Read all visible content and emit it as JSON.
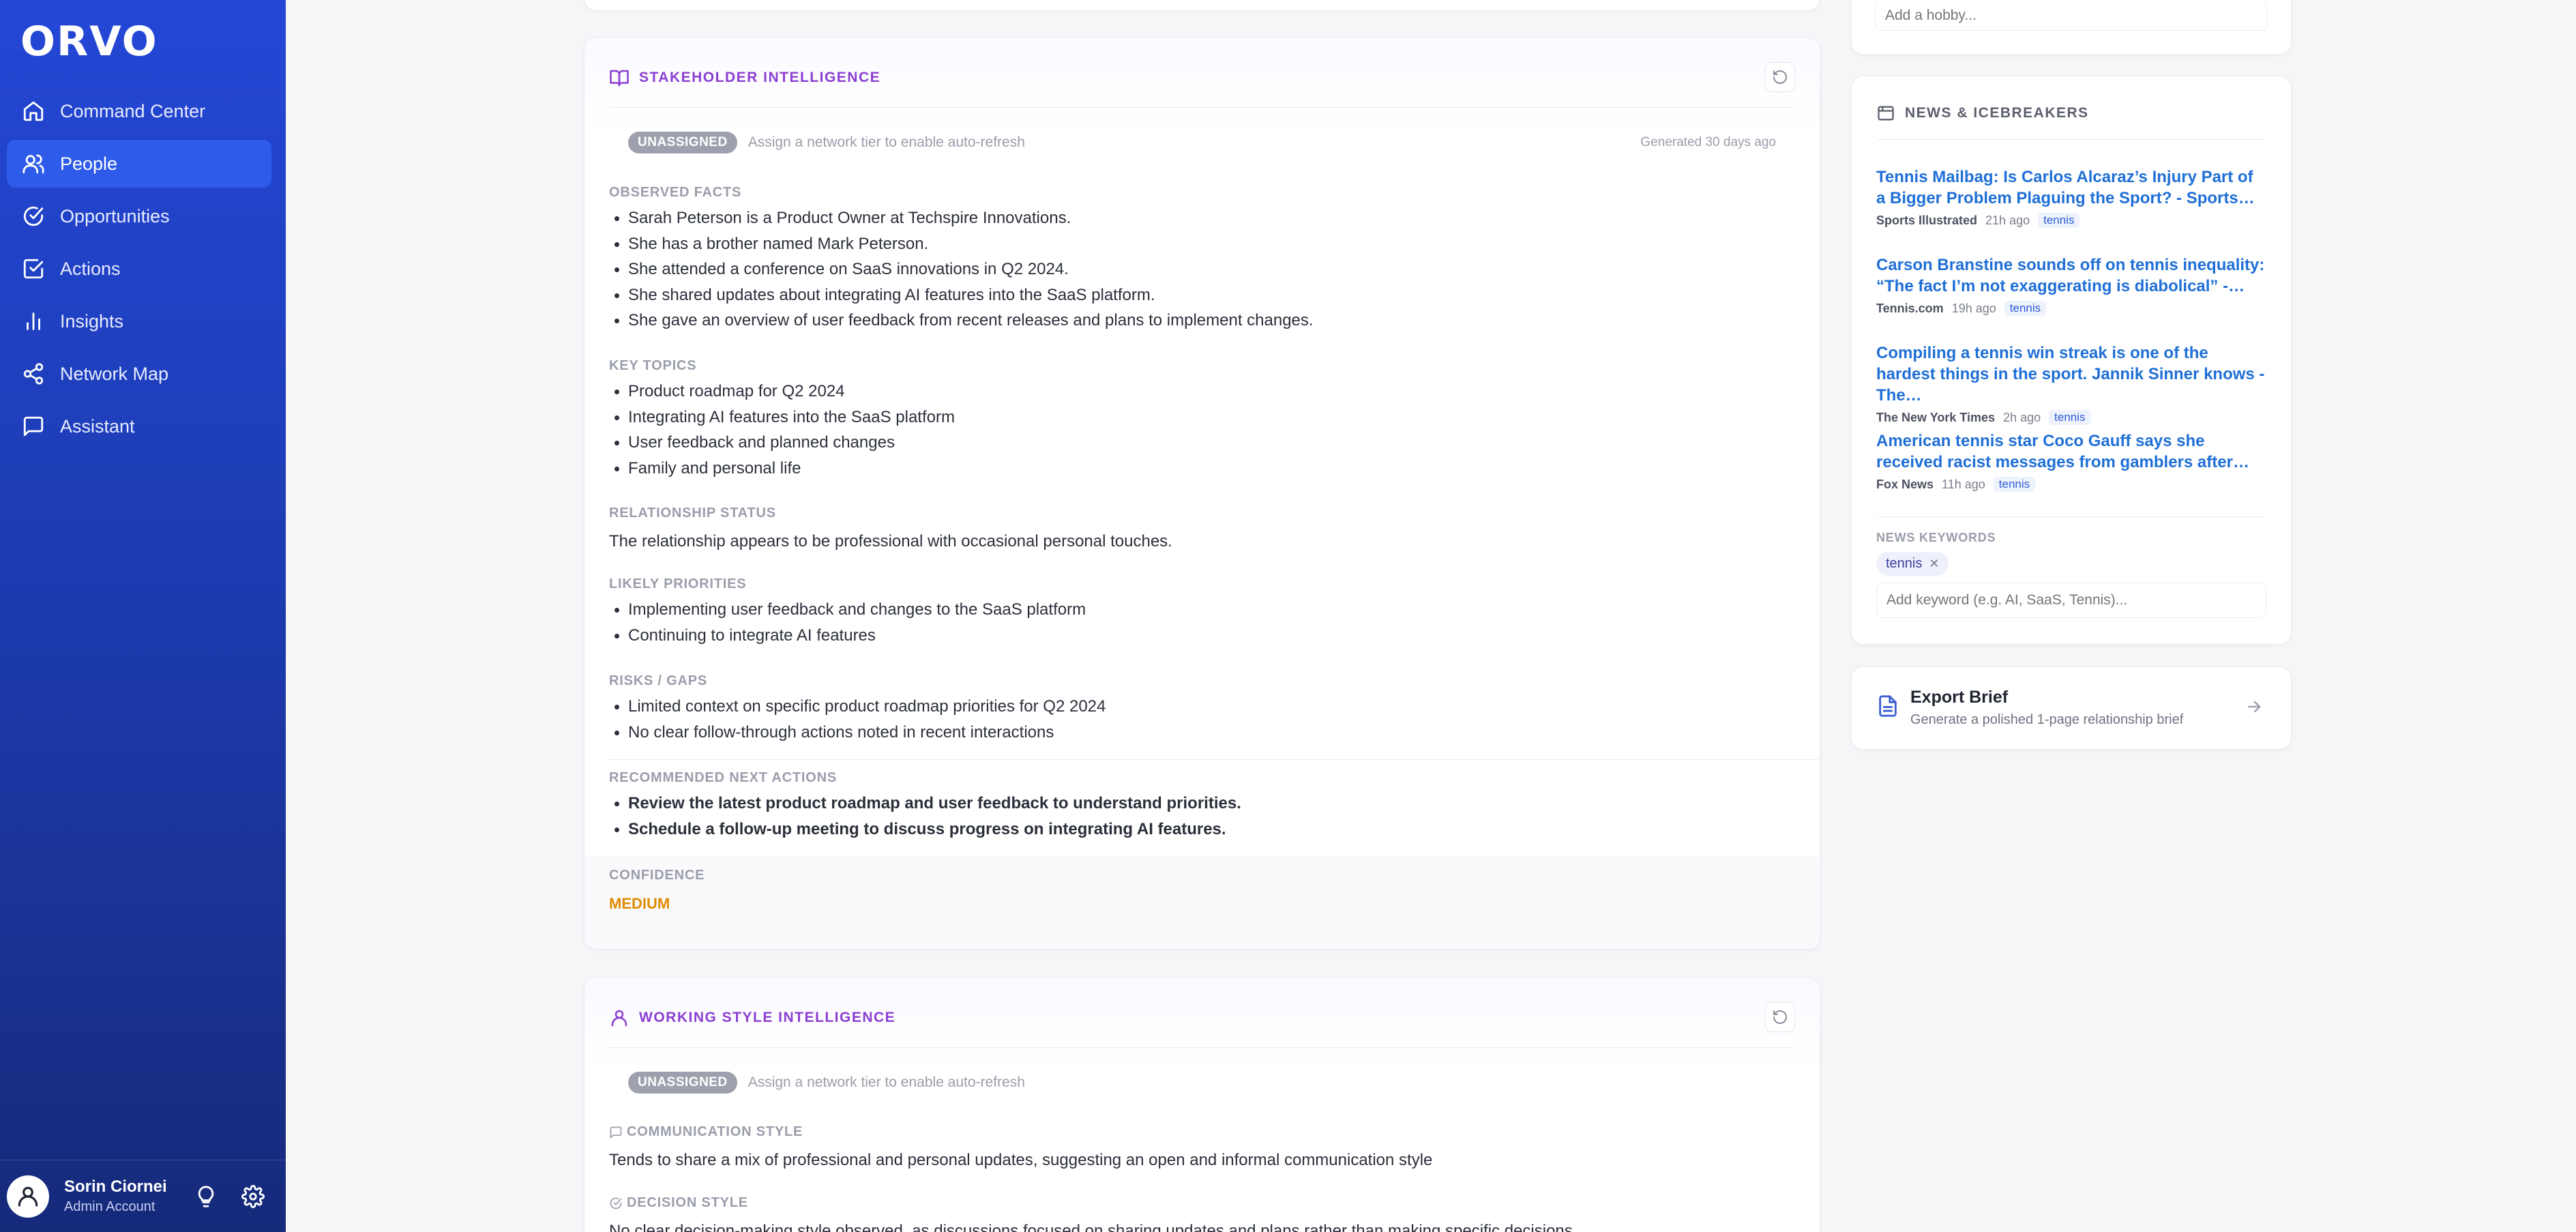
{
  "app": {
    "logo": "ORVO"
  },
  "sidebar": {
    "items": [
      {
        "label": "Command Center",
        "icon": "home-icon"
      },
      {
        "label": "People",
        "icon": "users-icon",
        "active": true
      },
      {
        "label": "Opportunities",
        "icon": "check-circle-icon"
      },
      {
        "label": "Actions",
        "icon": "check-square-icon"
      },
      {
        "label": "Insights",
        "icon": "bar-chart-icon"
      },
      {
        "label": "Network Map",
        "icon": "share-icon"
      },
      {
        "label": "Assistant",
        "icon": "message-square-icon"
      }
    ],
    "user": {
      "name": "Sorin Ciornei",
      "role": "Admin Account"
    }
  },
  "stakeholder": {
    "title": "STAKEHOLDER INTELLIGENCE",
    "badge": "UNASSIGNED",
    "hint": "Assign a network tier to enable auto-refresh",
    "generated": "Generated 30 days ago",
    "observed_label": "OBSERVED FACTS",
    "observed": [
      "Sarah Peterson is a Product Owner at Techspire Innovations.",
      "She has a brother named Mark Peterson.",
      "She attended a conference on SaaS innovations in Q2 2024.",
      "She shared updates about integrating AI features into the SaaS platform.",
      "She gave an overview of user feedback from recent releases and plans to implement changes."
    ],
    "topics_label": "KEY TOPICS",
    "topics": [
      "Product roadmap for Q2 2024",
      "Integrating AI features into the SaaS platform",
      "User feedback and planned changes",
      "Family and personal life"
    ],
    "relationship_label": "RELATIONSHIP STATUS",
    "relationship": "The relationship appears to be professional with occasional personal touches.",
    "priorities_label": "LIKELY PRIORITIES",
    "priorities": [
      "Implementing user feedback and changes to the SaaS platform",
      "Continuing to integrate AI features"
    ],
    "risks_label": "RISKS / GAPS",
    "risks": [
      "Limited context on specific product roadmap priorities for Q2 2024",
      "No clear follow-through actions noted in recent interactions"
    ],
    "actions_label": "RECOMMENDED NEXT ACTIONS",
    "actions": [
      "Review the latest product roadmap and user feedback to understand priorities.",
      "Schedule a follow-up meeting to discuss progress on integrating AI features."
    ],
    "confidence_label": "CONFIDENCE",
    "confidence": "MEDIUM",
    "confidence_color": "#e08a00"
  },
  "working_style": {
    "title": "WORKING STYLE INTELLIGENCE",
    "badge": "UNASSIGNED",
    "hint": "Assign a network tier to enable auto-refresh",
    "communication_label": "COMMUNICATION STYLE",
    "communication": "Tends to share a mix of professional and personal updates, suggesting an open and informal communication style",
    "decision_label": "DECISION STYLE",
    "decision": "No clear decision-making style observed, as discussions focused on sharing updates and plans rather than making specific decisions."
  },
  "hobby": {
    "placeholder": "Add a hobby..."
  },
  "news": {
    "title": "NEWS & ICEBREAKERS",
    "items": [
      {
        "title": "Tennis Mailbag: Is Carlos Alcaraz’s Injury Part of a Bigger Problem Plaguing the Sport? - Sports…",
        "source": "Sports Illustrated",
        "time": "21h ago",
        "tag": "tennis"
      },
      {
        "title": "Carson Branstine sounds off on tennis inequality: “The fact I’m not exaggerating is diabolical” -…",
        "source": "Tennis.com",
        "time": "19h ago",
        "tag": "tennis"
      },
      {
        "title": "Compiling a tennis win streak is one of the hardest things in the sport. Jannik Sinner knows - The…",
        "source": "The New York Times",
        "time": "2h ago",
        "tag": "tennis"
      },
      {
        "title": "American tennis star Coco Gauff says she received racist messages from gamblers after…",
        "source": "Fox News",
        "time": "11h ago",
        "tag": "tennis"
      }
    ],
    "keywords_label": "NEWS KEYWORDS",
    "keywords": [
      "tennis"
    ],
    "keyword_placeholder": "Add keyword (e.g. AI, SaaS, Tennis)..."
  },
  "export": {
    "title": "Export Brief",
    "subtitle": "Generate a polished 1-page relationship brief"
  }
}
